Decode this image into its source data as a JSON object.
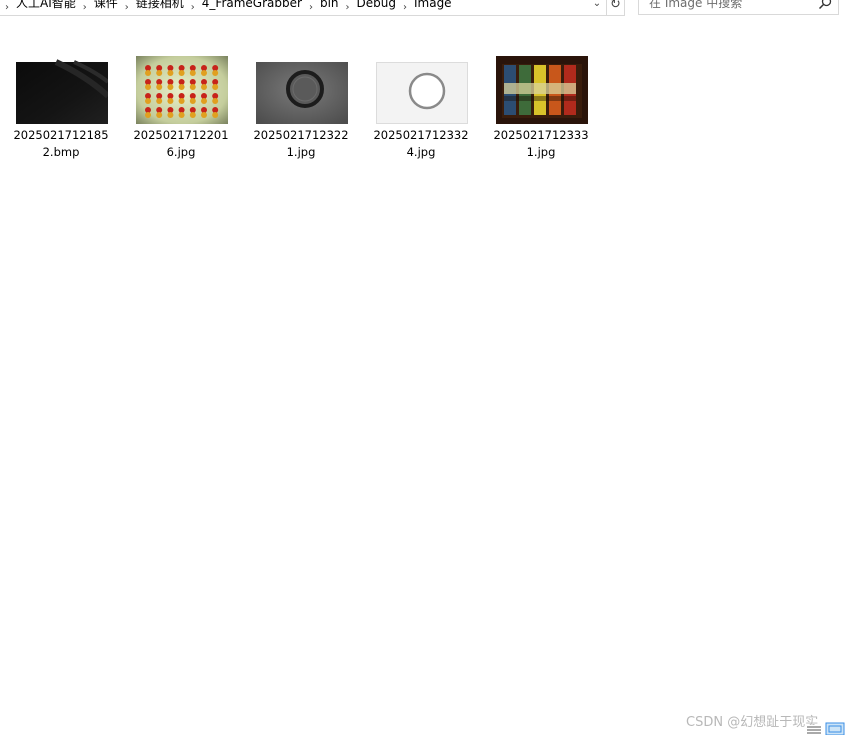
{
  "address": {
    "crumbs": [
      "人工AI智能",
      "课件",
      "链接相机",
      "4_FrameGrabber",
      "bin",
      "Debug",
      "Image"
    ]
  },
  "search": {
    "placeholder": "在 Image 中搜索"
  },
  "files": [
    {
      "name": "20250217121852.bmp",
      "line1": "2025021712185",
      "line2": "2.bmp",
      "thumb": "dark-image"
    },
    {
      "name": "20250217122016.jpg",
      "line1": "2025021712201",
      "line2": "6.jpg",
      "thumb": "capsules-grid"
    },
    {
      "name": "20250217123221.jpg",
      "line1": "2025021712322",
      "line2": "1.jpg",
      "thumb": "dark-ring"
    },
    {
      "name": "20250217123324.jpg",
      "line1": "2025021712332",
      "line2": "4.jpg",
      "thumb": "light-ring"
    },
    {
      "name": "20250217123331.jpg",
      "line1": "2025021712333",
      "line2": "1.jpg",
      "thumb": "color-blocks"
    }
  ],
  "watermark": "CSDN @幻想趾于现实",
  "colors": {
    "border": "#d9d9d9",
    "placeholder": "#6d6d6d",
    "watermark": "#b8b8b8"
  }
}
